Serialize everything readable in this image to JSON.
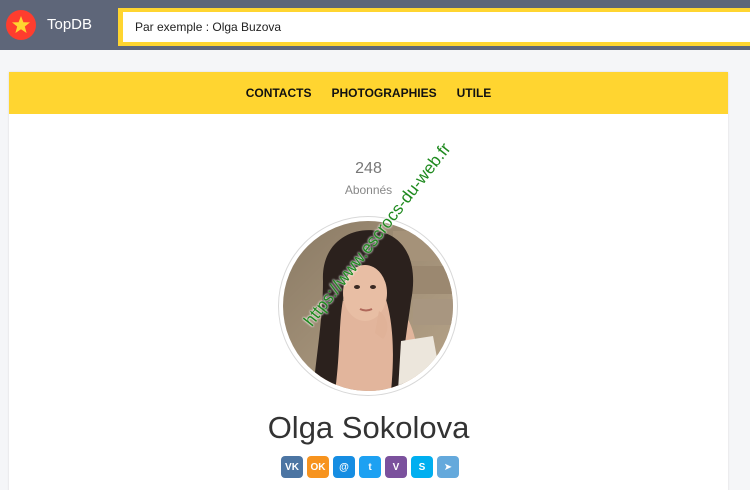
{
  "header": {
    "brand": "TopDB",
    "search_placeholder": "Par exemple : Olga Buzova"
  },
  "nav": {
    "items": [
      "CONTACTS",
      "PHOTOGRAPHIES",
      "UTILE"
    ]
  },
  "profile": {
    "subscriber_count": "248",
    "subscriber_label": "Abonnés",
    "name": "Olga Sokolova"
  },
  "socials": [
    {
      "icon": "vk-icon",
      "label": "VK",
      "color": "#4c75a3"
    },
    {
      "icon": "odnoklassniki-icon",
      "label": "OK",
      "color": "#f7931e"
    },
    {
      "icon": "moimir-icon",
      "label": "@",
      "color": "#168de2"
    },
    {
      "icon": "twitter-icon",
      "label": "t",
      "color": "#1da1f2"
    },
    {
      "icon": "viber-icon",
      "label": "V",
      "color": "#7b519d"
    },
    {
      "icon": "skype-icon",
      "label": "S",
      "color": "#00aff0"
    },
    {
      "icon": "telegram-icon",
      "label": "➤",
      "color": "#64a9dc"
    }
  ],
  "watermark": "https://www.escrocs-du-web.fr",
  "colors": {
    "header_bg": "#5e6679",
    "accent_yellow": "#ffd530",
    "logo_red": "#ff3d2e"
  }
}
